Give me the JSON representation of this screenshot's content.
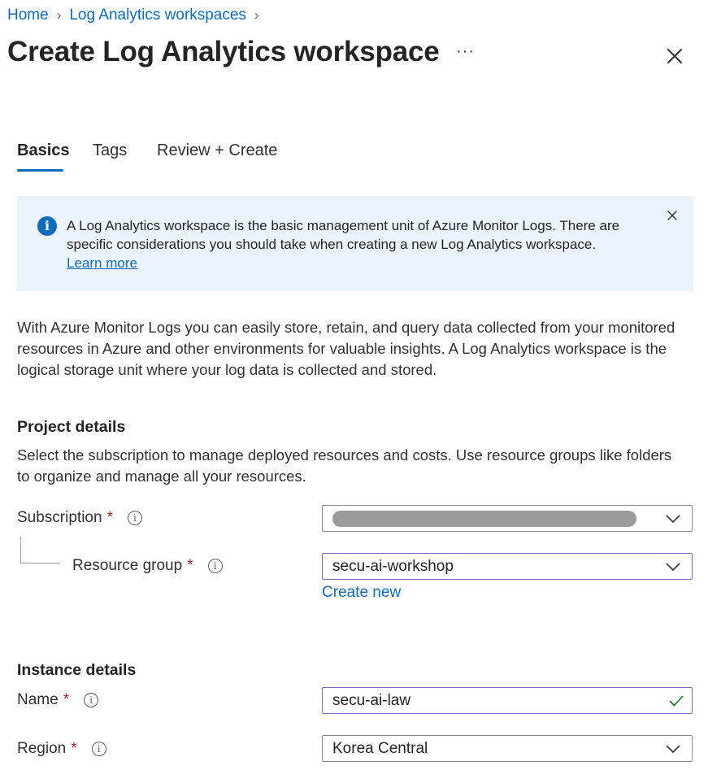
{
  "breadcrumb": {
    "items": [
      "Home",
      "Log Analytics workspaces"
    ]
  },
  "header": {
    "title": "Create Log Analytics workspace",
    "more_label": "···"
  },
  "tabs": [
    {
      "label": "Basics",
      "active": true
    },
    {
      "label": "Tags",
      "active": false
    },
    {
      "label": "Review + Create",
      "active": false
    }
  ],
  "banner": {
    "icon": "info-icon",
    "text": "A Log Analytics workspace is the basic management unit of Azure Monitor Logs. There are specific considerations you should take when creating a new Log Analytics workspace.",
    "link": "Learn more"
  },
  "intro": "With Azure Monitor Logs you can easily store, retain, and query data collected from your monitored resources in Azure and other environments for valuable insights. A Log Analytics workspace is the logical storage unit where your log data is collected and stored.",
  "project_details": {
    "title": "Project details",
    "description": "Select the subscription to manage deployed resources and costs. Use resource groups like folders to organize and manage all your resources.",
    "subscription_label": "Subscription",
    "resource_group_label": "Resource group",
    "resource_group_value": "secu-ai-workshop",
    "create_new": "Create new"
  },
  "instance_details": {
    "title": "Instance details",
    "name_label": "Name",
    "name_value": "secu-ai-law",
    "region_label": "Region",
    "region_value": "Korea Central"
  },
  "required_marker": "*",
  "colors": {
    "accent": "#0f6cbd",
    "banner_bg": "#ebf3fc",
    "required": "#a4262c",
    "valid": "#107c10",
    "focus_border": "#8764b8"
  }
}
